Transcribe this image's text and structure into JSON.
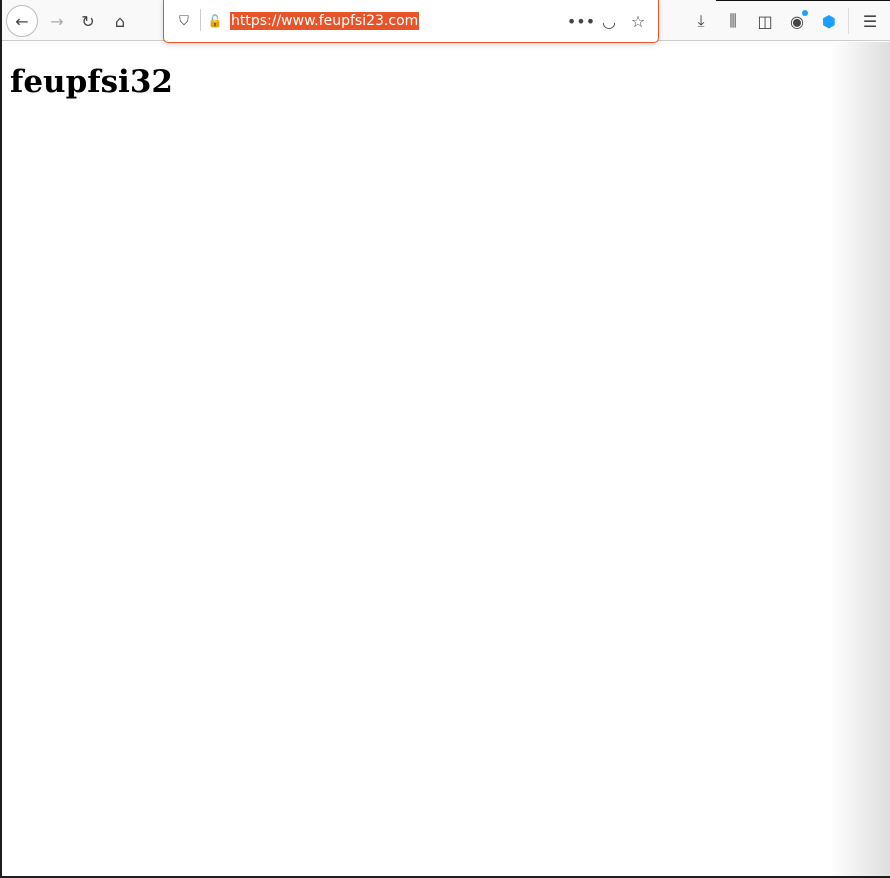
{
  "browser": {
    "url": "https://www.feupfsi23.com",
    "accent": "#e8542a",
    "nav_icons": [
      "back-icon",
      "forward-icon",
      "reload-icon",
      "home-icon"
    ],
    "right_icons": [
      "download-icon",
      "library-icon",
      "sidebar-icon",
      "account-icon",
      "extension-icon",
      "menu-icon"
    ]
  },
  "page": {
    "heading": "feupfsi32"
  }
}
